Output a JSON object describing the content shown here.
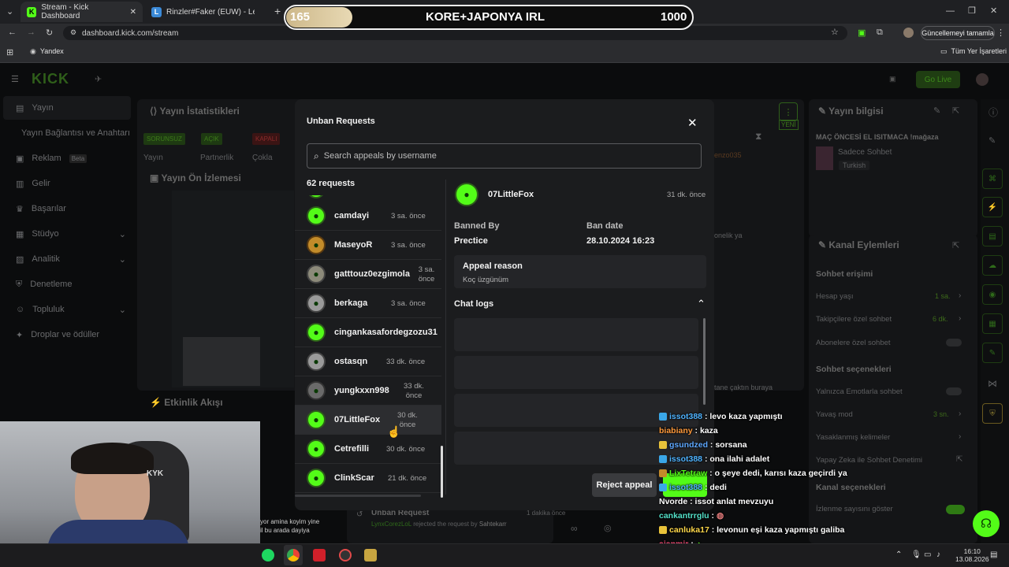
{
  "browser": {
    "tabs": [
      {
        "label": "Stream - Kick Dashboard",
        "favicon": "K"
      },
      {
        "label": "Rinzler#Faker (EUW) - LeagueO",
        "favicon": "L"
      }
    ],
    "url": "dashboard.kick.com/stream",
    "update_label": "Güncellemeyi tamamla",
    "bookmarks": {
      "yandex": "Yandex",
      "all": "Tüm Yer İşaretleri"
    }
  },
  "banner": {
    "left": "165",
    "title": "KORE+JAPONYA IRL",
    "right": "1000"
  },
  "dashboard": {
    "logo": "KICK",
    "go_live": "Go Live",
    "sidebar": [
      {
        "label": "Yayın"
      },
      {
        "label": "Yayın Bağlantısı ve Anahtarı"
      },
      {
        "label": "Reklam",
        "badge": "Beta"
      },
      {
        "label": "Gelir"
      },
      {
        "label": "Başarılar"
      },
      {
        "label": "Stüdyo"
      },
      {
        "label": "Analitik"
      },
      {
        "label": "Denetleme"
      },
      {
        "label": "Topluluk"
      },
      {
        "label": "Droplar ve ödüller"
      }
    ],
    "stats_title": "Yayın İstatistikleri",
    "stats_tags": [
      "SORUNSUZ",
      "AÇIK",
      "KAPALI"
    ],
    "stats_labels": [
      "Yayın",
      "Partnerlik",
      "Çokla"
    ],
    "preview_title": "Yayın Ön İzlemesi",
    "activity_title": "Etkinlik Akışı",
    "info_title": "Yayın bilgisi",
    "stream_title": "MAÇ ÖNCESİ EL ISITMACA !mağaza",
    "stream_category": "Sadece Sohbet",
    "stream_lang": "Turkish",
    "actions_title": "Kanal Eylemleri",
    "chat_access_title": "Sohbet erişimi",
    "chat_access": [
      {
        "label": "Hesap yaşı",
        "value": "1 sa."
      },
      {
        "label": "Takipçilere özel sohbet",
        "value": "6 dk."
      },
      {
        "label": "Abonelere özel sohbet",
        "value": ""
      }
    ],
    "chat_options_title": "Sohbet seçenekleri",
    "chat_options": [
      {
        "label": "Yalnızca Emotlarla sohbet",
        "value": ""
      },
      {
        "label": "Yavaş mod",
        "value": "3 sn."
      },
      {
        "label": "Yasaklanmış kelimeler",
        "value": ""
      },
      {
        "label": "Yapay Zeka ile Sohbet Denetimi",
        "value": ""
      }
    ],
    "channel_options_title": "Kanal seçenekleri",
    "viewer_count_label": "İzlenme sayısını göster",
    "new_badge": "YENİ",
    "unban_feed_title": "Unban Request",
    "unban_feed_user": "LynxCorezLoL",
    "unban_feed_text": "rejected the request by",
    "unban_feed_actor": "Sahtekarr",
    "unban_feed_time": "1 dakika önce"
  },
  "modal": {
    "title": "Unban Requests",
    "search_placeholder": "Search appeals by username",
    "count": "62 requests",
    "requests": [
      {
        "user": "camdayi",
        "time": "3 sa. önce"
      },
      {
        "user": "MaseyoR",
        "time": "3 sa. önce"
      },
      {
        "user": "gatttouz0ezgimola",
        "time": "3 sa. önce"
      },
      {
        "user": "berkaga",
        "time": "3 sa. önce"
      },
      {
        "user": "cingankasafordegzozu31",
        "time": ""
      },
      {
        "user": "ostasqn",
        "time": "33 dk. önce"
      },
      {
        "user": "yungkxxn998",
        "time": "33 dk. önce"
      },
      {
        "user": "07LittleFox",
        "time": "30 dk. önce"
      },
      {
        "user": "Cetrefilli",
        "time": "30 dk. önce"
      },
      {
        "user": "ClinkScar",
        "time": "21 dk. önce"
      }
    ],
    "detail": {
      "user": "07LittleFox",
      "time": "31 dk. önce",
      "banned_by_label": "Banned By",
      "banned_by": "Prectice",
      "ban_date_label": "Ban date",
      "ban_date": "28.10.2024 16:23",
      "appeal_label": "Appeal reason",
      "appeal_text": "Koç üzgünüm",
      "chat_logs_label": "Chat logs",
      "reject_label": "Reject appeal"
    }
  },
  "chat_overlay": [
    {
      "user": "issot388",
      "text": ": levo kaza yapmıştı",
      "color": "#4fb3ff"
    },
    {
      "user": "biabiany",
      "text": ": kaza",
      "color": "#ff9a3c"
    },
    {
      "user": "gsundzed",
      "text": ": sorsana",
      "color": "#5ea8ff"
    },
    {
      "user": "issot388",
      "text": ": ona ilahi adalet",
      "color": "#4fb3ff"
    },
    {
      "user": "LixTetraw",
      "text": ": o şeye dedi, karısı kaza geçirdi ya",
      "color": "#53fc18"
    },
    {
      "user": "issot388",
      "text": ": dedi",
      "color": "#4fb3ff"
    },
    {
      "user": "Nvorde",
      "text": ": issot anlat mevzuyu",
      "color": "#ffffff"
    },
    {
      "user": "cankantrrglu",
      "text": ":",
      "color": "#53e0c8"
    },
    {
      "user": "canluka17",
      "text": ": levonun eşi kaza yapmıştı galiba",
      "color": "#ffd84a"
    },
    {
      "user": "ajanmir",
      "text": ":",
      "color": "#ff4d7a"
    }
  ],
  "stream_overlay_lines": [
    "yor amina koyim yine",
    "il bu arada dayiya"
  ],
  "taskbar": {
    "time": "16:10",
    "date": "13.08.2026"
  },
  "colors": {
    "kick_green": "#53fc18",
    "modal_bg": "#1b1c1e"
  }
}
